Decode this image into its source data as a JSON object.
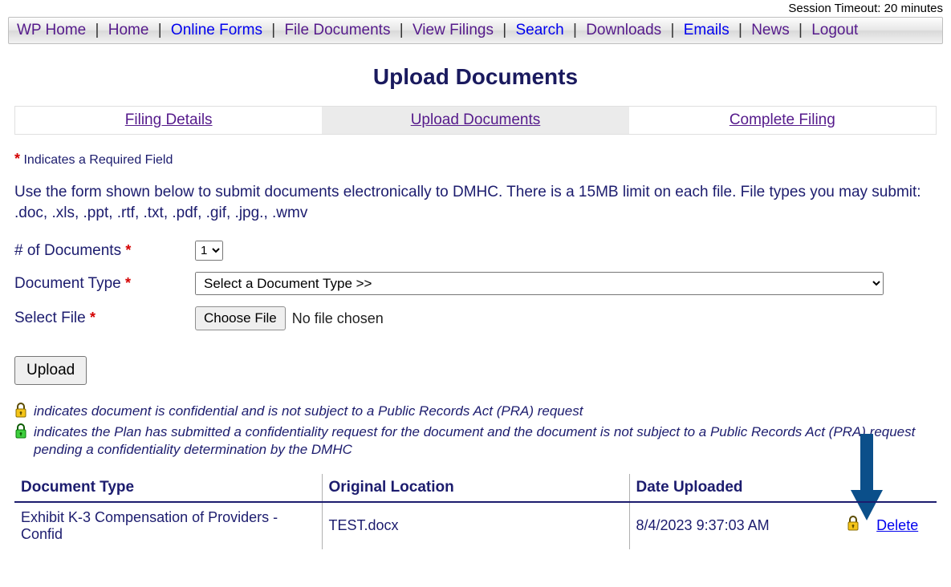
{
  "session_timeout_text": "Session Timeout: 20 minutes",
  "nav": {
    "items": [
      {
        "label": "WP Home",
        "style": "purple"
      },
      {
        "label": "Home",
        "style": "purple"
      },
      {
        "label": "Online Forms",
        "style": "blue"
      },
      {
        "label": "File Documents",
        "style": "purple"
      },
      {
        "label": "View Filings",
        "style": "purple"
      },
      {
        "label": "Search",
        "style": "blue"
      },
      {
        "label": "Downloads",
        "style": "purple"
      },
      {
        "label": "Emails",
        "style": "blue"
      },
      {
        "label": "News",
        "style": "purple"
      },
      {
        "label": "Logout",
        "style": "purple"
      }
    ]
  },
  "page_title": "Upload Documents",
  "steps": {
    "items": [
      {
        "label": "Filing Details",
        "active": false
      },
      {
        "label": "Upload Documents",
        "active": true
      },
      {
        "label": "Complete Filing",
        "active": false
      }
    ]
  },
  "required_note": "Indicates a Required Field",
  "intro_text": "Use the form shown below to submit documents electronically to DMHC. There is a 15MB limit on each file. File types you may submit: .doc, .xls, .ppt, .rtf, .txt, .pdf, .gif, .jpg., .wmv",
  "form": {
    "num_docs_label": "# of Documents",
    "num_docs_value": "1",
    "doc_type_label": "Document Type",
    "doc_type_placeholder": "Select a Document Type >>",
    "select_file_label": "Select File",
    "choose_file_btn": "Choose File",
    "file_status": "No file chosen",
    "upload_btn": "Upload"
  },
  "legend": {
    "gold_text": "indicates document is confidential and is not subject to a Public Records Act (PRA) request",
    "green_text": "indicates the Plan has submitted a confidentiality request for the document and the document is not subject to a Public Records Act (PRA) request pending a confidentiality determination by the DMHC"
  },
  "table": {
    "headers": {
      "doc_type": "Document Type",
      "orig_loc": "Original Location",
      "date_up": "Date Uploaded"
    },
    "row": {
      "doc_type": "Exhibit K-3 Compensation of Providers - Confid",
      "orig_loc": "TEST.docx",
      "date_up": "8/4/2023 9:37:03 AM",
      "delete_label": "Delete"
    }
  }
}
